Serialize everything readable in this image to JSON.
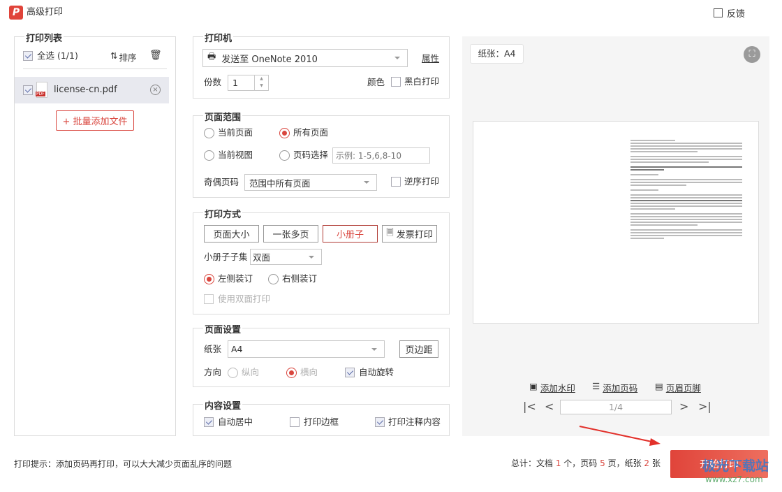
{
  "window": {
    "title": "高级打印",
    "feedback": "反馈"
  },
  "print_list": {
    "legend": "打印列表",
    "select_all": "全选 (1/1)",
    "sort": "排序",
    "files": [
      {
        "name": "license-cn.pdf",
        "checked": true,
        "icon_badge": "PDF"
      }
    ],
    "add_files": "+ 批量添加文件"
  },
  "printer": {
    "legend": "打印机",
    "selected": "发送至 OneNote 2010",
    "properties": "属性",
    "copies_label": "份数",
    "copies": "1",
    "color_label": "颜色",
    "bw_label": "黑白打印"
  },
  "range": {
    "legend": "页面范围",
    "current_page": "当前页面",
    "all_pages": "所有页面",
    "current_view": "当前视图",
    "page_select": "页码选择",
    "page_placeholder": "示例: 1-5,6,8-10",
    "odd_even_label": "奇偶页码",
    "odd_even_value": "范围中所有页面",
    "reverse": "逆序打印"
  },
  "mode": {
    "legend": "打印方式",
    "buttons": [
      "页面大小",
      "一张多页",
      "小册子",
      "发票打印"
    ],
    "subset_label": "小册子子集",
    "subset_value": "双面",
    "left_bind": "左侧装订",
    "right_bind": "右侧装订",
    "duplex": "使用双面打印"
  },
  "page_setup": {
    "legend": "页面设置",
    "paper_label": "纸张",
    "paper_value": "A4",
    "margins": "页边距",
    "orientation_label": "方向",
    "portrait": "纵向",
    "landscape": "横向",
    "auto_rotate": "自动旋转"
  },
  "content": {
    "legend": "内容设置",
    "center": "自动居中",
    "border": "打印边框",
    "annotations": "打印注释内容"
  },
  "preview": {
    "paper_chip": "纸张：A4",
    "watermark": "添加水印",
    "page_number": "添加页码",
    "header_footer": "页眉页脚",
    "page_indicator": "1/4"
  },
  "footer": {
    "tip": "打印提示：添加页码再打印，可以大大减少页面乱序的问题",
    "total_prefix": "总计：文档 ",
    "docs": "1",
    "docs_unit": " 个，页码 ",
    "pages": "5",
    "pages_unit": " 页，纸张 ",
    "sheets": "2",
    "sheets_unit": " 张",
    "start": "开始打印"
  },
  "site_watermark": {
    "name": "极光下载站",
    "url": "www.xz7.com"
  },
  "colors": {
    "accent": "#d9463e",
    "button": "#e24a3b"
  }
}
